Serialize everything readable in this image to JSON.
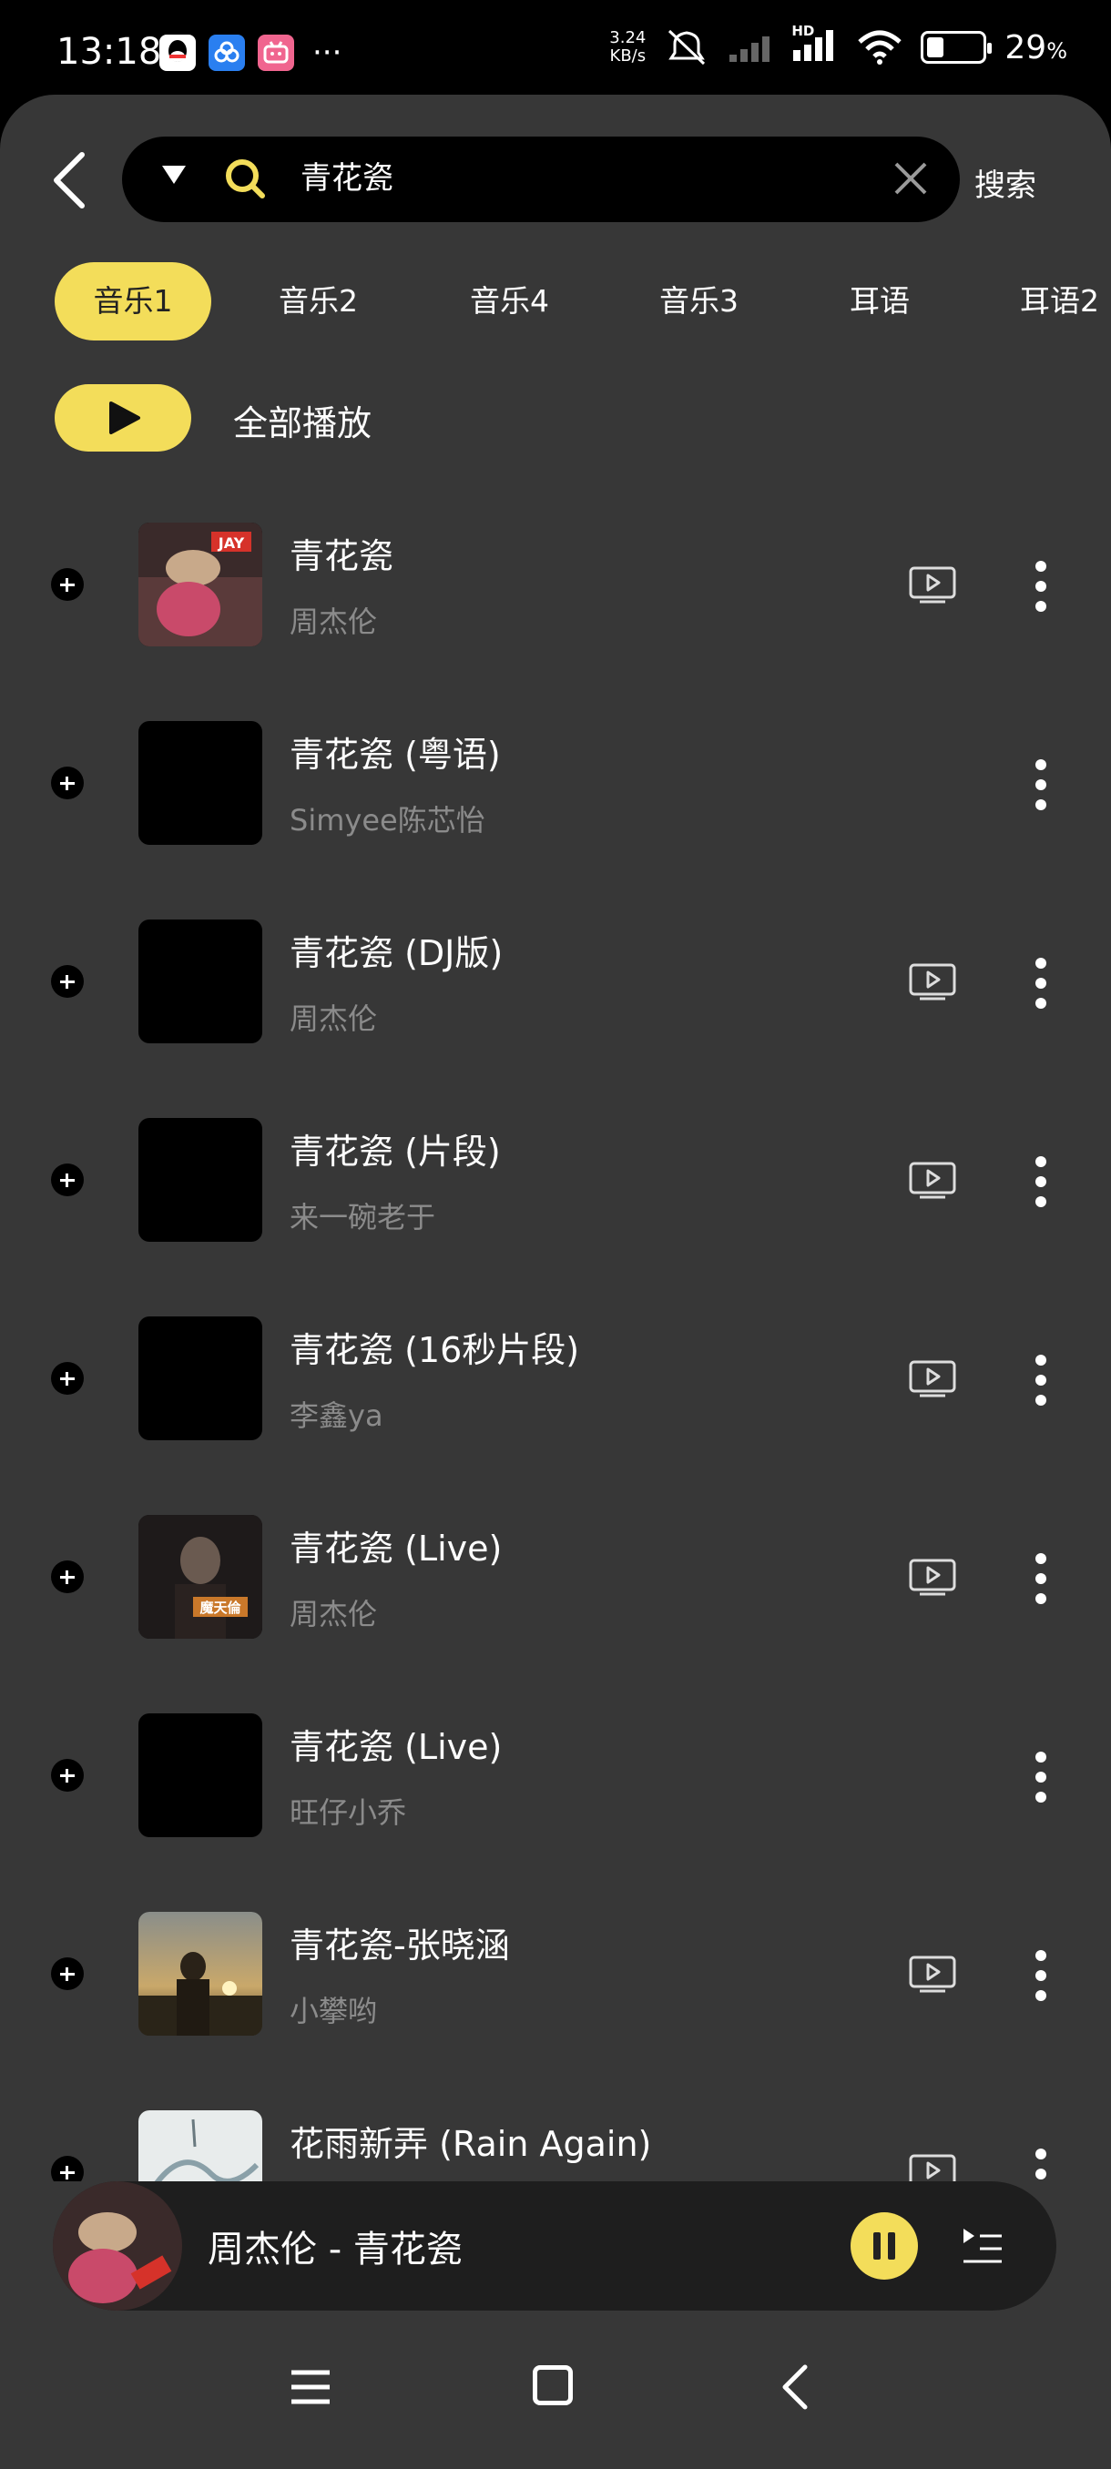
{
  "status_bar": {
    "time": "13:18",
    "net_speed_value": "3.24",
    "net_speed_unit": "KB/s",
    "battery_percent": "29",
    "battery_percent_sign": "%",
    "signal_label": "HD"
  },
  "search": {
    "query": "青花瓷",
    "button_label": "搜索"
  },
  "tabs": [
    {
      "label": "音乐1",
      "active": true
    },
    {
      "label": "音乐2"
    },
    {
      "label": "音乐4"
    },
    {
      "label": "音乐3"
    },
    {
      "label": "耳语"
    },
    {
      "label": "耳语2"
    }
  ],
  "play_all_label": "全部播放",
  "songs": [
    {
      "title": "青花瓷",
      "artist": "周杰伦",
      "has_mv": true,
      "cover_label": "JAY"
    },
    {
      "title": "青花瓷 (粤语)",
      "artist": "Simyee陈芯怡",
      "has_mv": false
    },
    {
      "title": "青花瓷 (DJ版)",
      "artist": "周杰伦",
      "has_mv": true
    },
    {
      "title": "青花瓷 (片段)",
      "artist": "来一碗老于",
      "has_mv": true
    },
    {
      "title": "青花瓷 (16秒片段)",
      "artist": "李鑫ya",
      "has_mv": true
    },
    {
      "title": "青花瓷 (Live)",
      "artist": "周杰伦",
      "has_mv": true,
      "cover_label": "魔天倫"
    },
    {
      "title": "青花瓷 (Live)",
      "artist": "旺仔小乔",
      "has_mv": false
    },
    {
      "title": "青花瓷-张晓涵",
      "artist": "小攀哟",
      "has_mv": true
    },
    {
      "title": "花雨新弄 (Rain Again)",
      "artist": "",
      "has_mv": true
    }
  ],
  "mini_player": {
    "title": "周杰伦 - 青花瓷"
  },
  "colors": {
    "accent": "#f3dd5a",
    "background": "#373737",
    "search_bg": "#000000",
    "subtitle": "#8b8b8b"
  }
}
